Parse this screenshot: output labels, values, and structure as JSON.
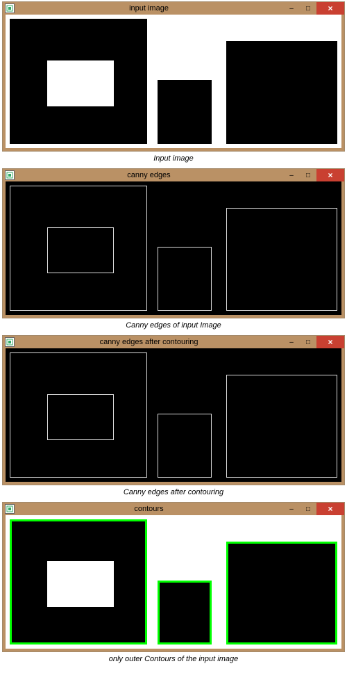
{
  "windows": [
    {
      "title": "input image"
    },
    {
      "title": "canny edges"
    },
    {
      "title": "canny edges after contouring"
    },
    {
      "title": "contours"
    }
  ],
  "captions": {
    "input": "Input image",
    "canny": "Canny edges of input Image",
    "canny_contour": "Canny edges after contouring",
    "contours": "only outer Contours of the input image"
  },
  "winbuttons": {
    "minimize": "–",
    "maximize": "□",
    "close": "×"
  }
}
